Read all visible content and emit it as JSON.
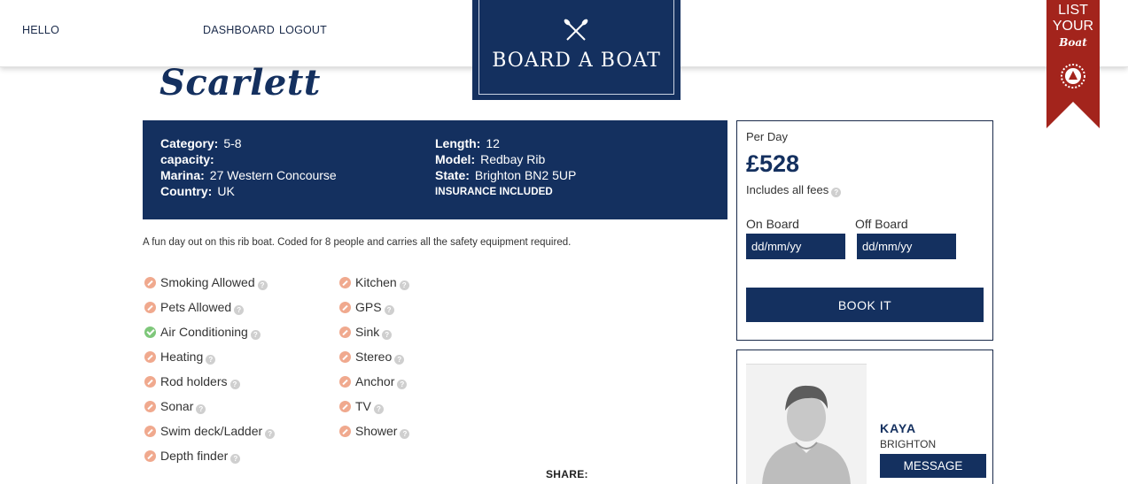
{
  "nav": {
    "hello": "HELLO",
    "dashboard": "DASHBOARD",
    "logout": "LOGOUT"
  },
  "logo": {
    "text": "BOARD A BOAT",
    "icon": "crossed-oars-icon"
  },
  "ribbon": {
    "line1": "LIST",
    "line2": "YOUR",
    "script": "Boat",
    "icon": "boat-badge-icon",
    "color": "#a3241c"
  },
  "boat": {
    "name": "Scarlett",
    "specs_left": [
      {
        "label": "Category:",
        "value": "5-8"
      },
      {
        "label": "capacity:",
        "value": ""
      },
      {
        "label": "Marina:",
        "value": "27 Western Concourse"
      },
      {
        "label": "Country:",
        "value": "UK"
      }
    ],
    "specs_right": [
      {
        "label": "Length:",
        "value": "12"
      },
      {
        "label": "Model:",
        "value": "Redbay Rib"
      },
      {
        "label": "State:",
        "value": "Brighton BN2 5UP"
      }
    ],
    "insurance": "INSURANCE INCLUDED",
    "description": "A fun day out on this rib boat. Coded for 8 people and carries all the safety equipment required."
  },
  "amenities_left": [
    {
      "label": "Smoking Allowed",
      "available": false
    },
    {
      "label": "Pets Allowed",
      "available": false
    },
    {
      "label": "Air Conditioning",
      "available": true
    },
    {
      "label": "Heating",
      "available": false
    },
    {
      "label": "Rod holders",
      "available": false
    },
    {
      "label": "Sonar",
      "available": false
    },
    {
      "label": "Swim deck/Ladder",
      "available": false
    },
    {
      "label": "Depth finder",
      "available": false
    }
  ],
  "amenities_right": [
    {
      "label": "Kitchen",
      "available": false
    },
    {
      "label": "GPS",
      "available": false
    },
    {
      "label": "Sink",
      "available": false
    },
    {
      "label": "Stereo",
      "available": false
    },
    {
      "label": "Anchor",
      "available": false
    },
    {
      "label": "TV",
      "available": false
    },
    {
      "label": "Shower",
      "available": false
    }
  ],
  "share_label": "SHARE:",
  "booking": {
    "per_day": "Per Day",
    "price": "£528",
    "fees": "Includes all fees",
    "on_board_label": "On Board",
    "off_board_label": "Off Board",
    "on_board_placeholder": "dd/mm/yy",
    "off_board_placeholder": "dd/mm/yy",
    "book_button": "BOOK IT"
  },
  "owner": {
    "name": "KAYA",
    "location": "BRIGHTON",
    "message_button": "MESSAGE"
  },
  "colors": {
    "navy": "#14305f",
    "red": "#a3241c",
    "no_icon": "#f0a98e",
    "yes_icon": "#7ec77a"
  }
}
